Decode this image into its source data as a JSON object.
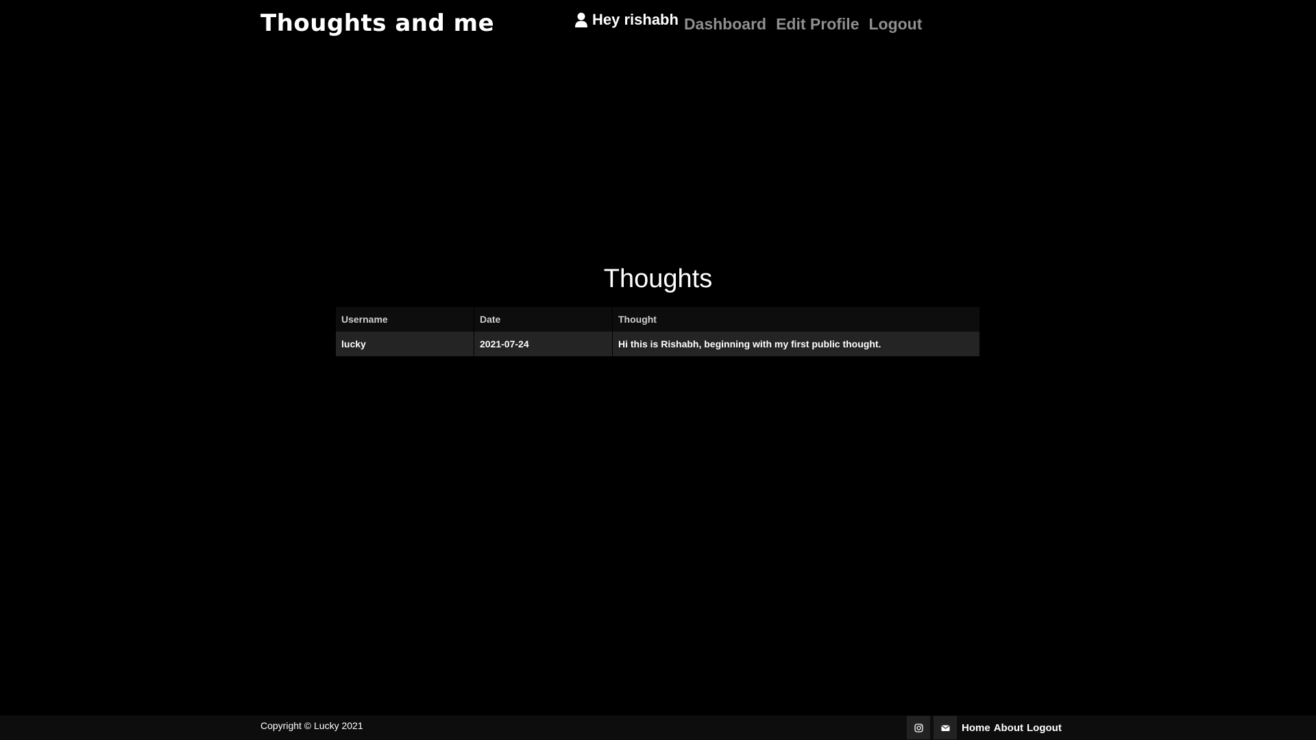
{
  "header": {
    "brand": "Thoughts and me",
    "greeting": "Hey rishabh",
    "nav": [
      {
        "label": "Dashboard"
      },
      {
        "label": "Edit Profile"
      },
      {
        "label": "Logout"
      }
    ]
  },
  "main": {
    "title": "Thoughts",
    "table": {
      "columns": [
        "Username",
        "Date",
        "Thought"
      ],
      "rows": [
        {
          "username": "lucky",
          "date": "2021-07-24",
          "thought": "Hi this is Rishabh, beginning with my first public thought."
        }
      ]
    }
  },
  "footer": {
    "copyright": "Copyright © Lucky 2021",
    "social": [
      {
        "icon": "instagram-icon"
      },
      {
        "icon": "envelope-icon"
      }
    ],
    "links": [
      {
        "label": "Home"
      },
      {
        "label": "About"
      },
      {
        "label": "Logout"
      }
    ]
  },
  "colors": {
    "background": "#000000",
    "nav_link": "#8f8f8f",
    "table_header_bg": "#0d0d0d",
    "table_row_bg": "#242424",
    "footer_bg": "#0d0d0d"
  }
}
